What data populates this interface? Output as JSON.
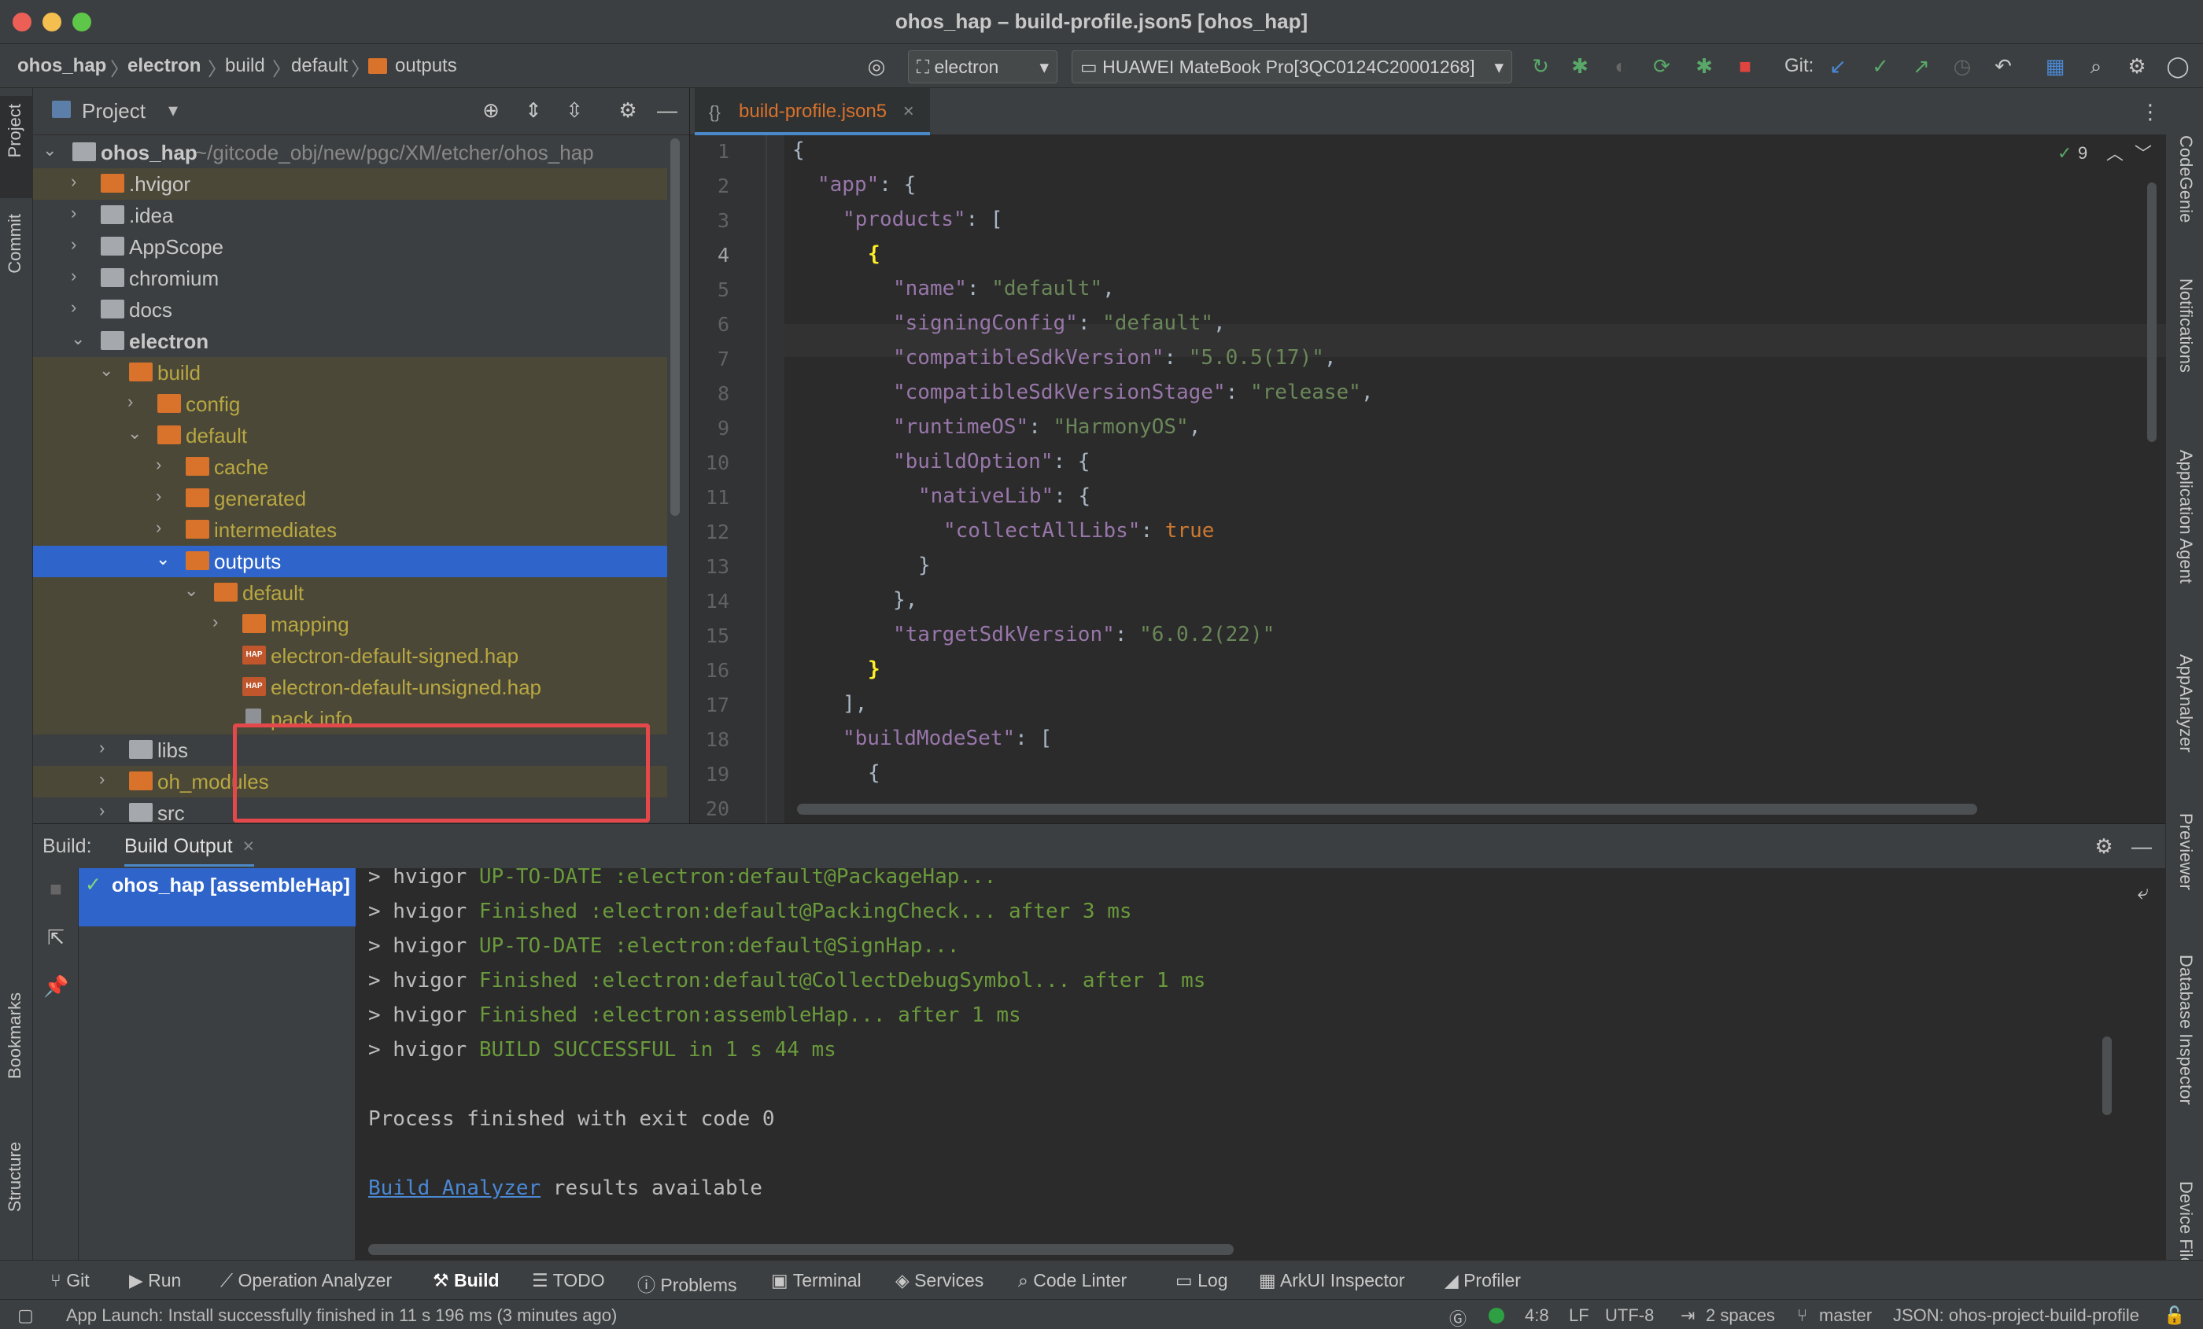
{
  "window": {
    "title": "ohos_hap – build-profile.json5 [ohos_hap]"
  },
  "breadcrumb": [
    "ohos_hap",
    "electron",
    "build",
    "default",
    "outputs"
  ],
  "toolbar": {
    "module_select": "electron",
    "device_select": "HUAWEI MateBook Pro[3QC0124C20001268]",
    "git_label": "Git:"
  },
  "left_strip": {
    "project": "Project",
    "commit": "Commit",
    "bookmarks": "Bookmarks",
    "structure": "Structure"
  },
  "right_strip": [
    "CodeGenie",
    "Notifications",
    "Application Agent",
    "AppAnalyzer",
    "Previewer",
    "Database Inspector",
    "Device File"
  ],
  "project_panel": {
    "title": "Project",
    "root_name": "ohos_hap",
    "root_path": "~/gitcode_obj/new/pgc/XM/etcher/ohos_hap",
    "items": [
      ".hvigor",
      ".idea",
      "AppScope",
      "chromium",
      "docs",
      "electron",
      "build",
      "config",
      "default",
      "cache",
      "generated",
      "intermediates",
      "outputs",
      "default",
      "mapping",
      "electron-default-signed.hap",
      "electron-default-unsigned.hap",
      "pack.info",
      "libs",
      "oh_modules",
      "src"
    ]
  },
  "editor": {
    "tab": "build-profile.json5",
    "inspection_count": "9",
    "lines": [
      {
        "n": "1"
      },
      {
        "n": "2"
      },
      {
        "n": "3"
      },
      {
        "n": "4"
      },
      {
        "n": "5"
      },
      {
        "n": "6"
      },
      {
        "n": "7"
      },
      {
        "n": "8"
      },
      {
        "n": "9"
      },
      {
        "n": "10"
      },
      {
        "n": "11"
      },
      {
        "n": "12"
      },
      {
        "n": "13"
      },
      {
        "n": "14"
      },
      {
        "n": "15"
      },
      {
        "n": "16"
      },
      {
        "n": "17"
      },
      {
        "n": "18"
      },
      {
        "n": "19"
      },
      {
        "n": "20"
      }
    ],
    "code": {
      "app": "\"app\"",
      "products": "\"products\"",
      "name_k": "\"name\"",
      "name_v": "\"default\"",
      "signing_k": "\"signingConfig\"",
      "signing_v": "\"default\"",
      "csv_k": "\"compatibleSdkVersion\"",
      "csv_v": "\"5.0.5(17)\"",
      "csvs_k": "\"compatibleSdkVersionStage\"",
      "csvs_v": "\"release\"",
      "ros_k": "\"runtimeOS\"",
      "ros_v": "\"HarmonyOS\"",
      "bo_k": "\"buildOption\"",
      "nl_k": "\"nativeLib\"",
      "cal_k": "\"collectAllLibs\"",
      "cal_v": "true",
      "tsv_k": "\"targetSdkVersion\"",
      "tsv_v": "\"6.0.2(22)\"",
      "bms_k": "\"buildModeSet\""
    }
  },
  "build": {
    "label": "Build:",
    "tab": "Build Output",
    "task": "ohos_hap [assembleHap]",
    "console": [
      {
        "pre": "> hvigor ",
        "msg": "UP-TO-DATE :electron:default@PackageHap..."
      },
      {
        "pre": "> hvigor ",
        "msg": "Finished :electron:default@PackingCheck... after 3 ms"
      },
      {
        "pre": "> hvigor ",
        "msg": "UP-TO-DATE :electron:default@SignHap..."
      },
      {
        "pre": "> hvigor ",
        "msg": "Finished :electron:default@CollectDebugSymbol... after 1 ms"
      },
      {
        "pre": "> hvigor ",
        "msg": "Finished :electron:assembleHap... after 1 ms"
      },
      {
        "pre": "> hvigor ",
        "msg": "BUILD SUCCESSFUL in 1 s 44 ms"
      }
    ],
    "exit": "Process finished with exit code 0",
    "analyzer_link": "Build Analyzer",
    "analyzer_rest": " results available"
  },
  "bottom_tools": [
    "Git",
    "Run",
    "Operation Analyzer",
    "Build",
    "TODO",
    "Problems",
    "Terminal",
    "Services",
    "Code Linter",
    "Log",
    "ArkUI Inspector",
    "Profiler"
  ],
  "status": {
    "message": "App Launch: Install successfully finished in 11 s 196 ms (3 minutes ago)",
    "position": "4:8",
    "line_sep": "LF",
    "encoding": "UTF-8",
    "indent": "2 spaces",
    "branch": "master",
    "schema": "JSON: ohos-project-build-profile"
  },
  "colors": {
    "accent": "#2f65ca",
    "folder": "#d9722b",
    "success": "#6a9a3c",
    "error_box": "#e4484b"
  }
}
